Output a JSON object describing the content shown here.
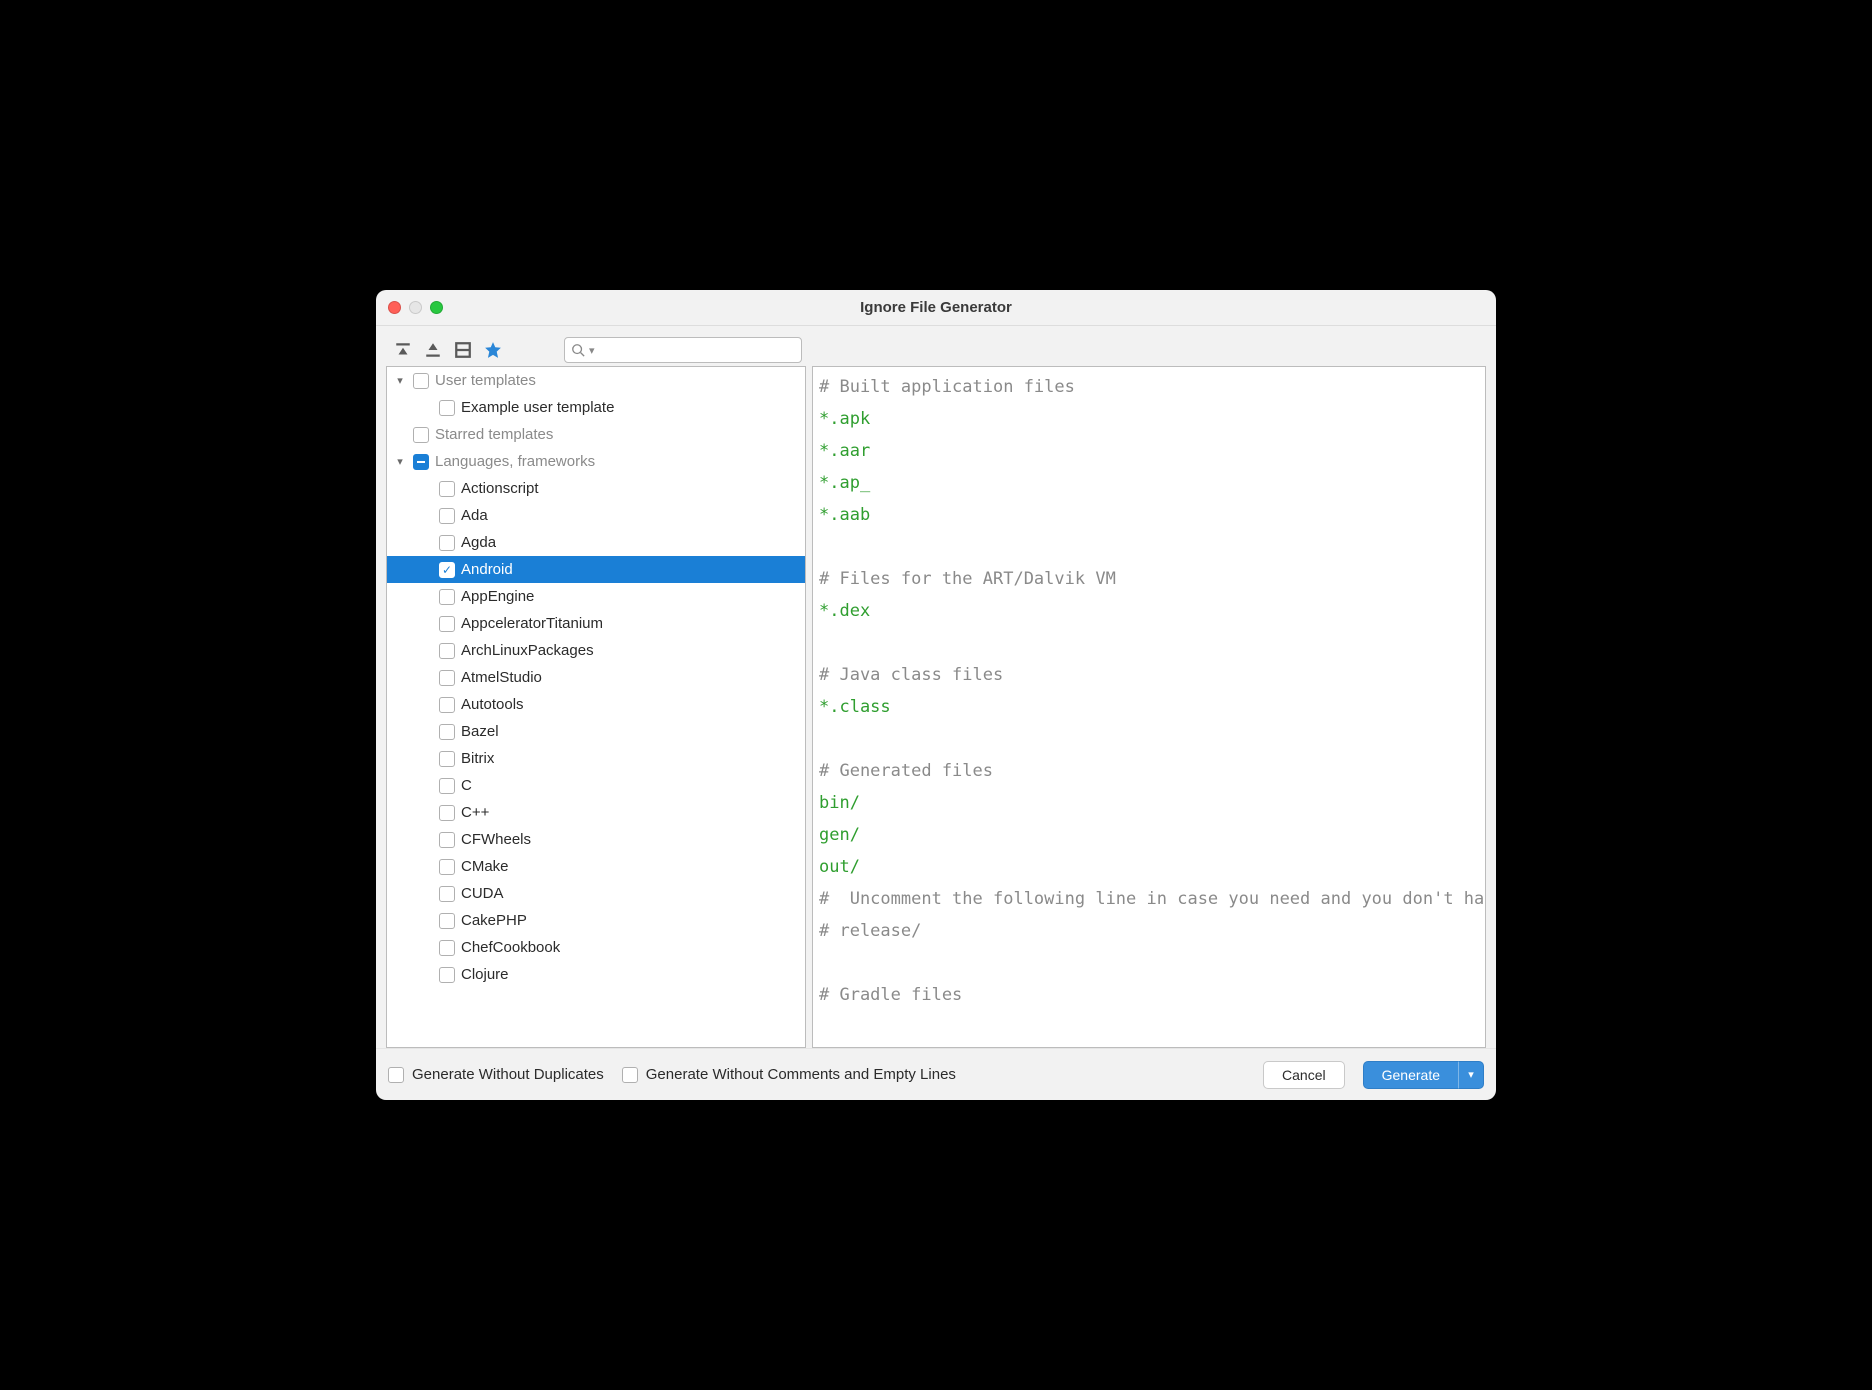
{
  "window": {
    "title": "Ignore File Generator"
  },
  "search": {
    "placeholder": ""
  },
  "tree": {
    "user_templates": {
      "label": "User templates",
      "expanded": true,
      "checked": false,
      "children": [
        {
          "id": "example",
          "label": "Example user template",
          "checked": false
        }
      ]
    },
    "starred_templates": {
      "label": "Starred templates",
      "checked": false
    },
    "languages": {
      "label": "Languages, frameworks",
      "expanded": true,
      "state": "indeterminate",
      "items": [
        {
          "id": "actionscript",
          "label": "Actionscript",
          "checked": false
        },
        {
          "id": "ada",
          "label": "Ada",
          "checked": false
        },
        {
          "id": "agda",
          "label": "Agda",
          "checked": false
        },
        {
          "id": "android",
          "label": "Android",
          "checked": true,
          "selected": true
        },
        {
          "id": "appengine",
          "label": "AppEngine",
          "checked": false
        },
        {
          "id": "appceleratortitanium",
          "label": "AppceleratorTitanium",
          "checked": false
        },
        {
          "id": "archlinuxpackages",
          "label": "ArchLinuxPackages",
          "checked": false
        },
        {
          "id": "atmelstudio",
          "label": "AtmelStudio",
          "checked": false
        },
        {
          "id": "autotools",
          "label": "Autotools",
          "checked": false
        },
        {
          "id": "bazel",
          "label": "Bazel",
          "checked": false
        },
        {
          "id": "bitrix",
          "label": "Bitrix",
          "checked": false
        },
        {
          "id": "c",
          "label": "C",
          "checked": false
        },
        {
          "id": "cpp",
          "label": "C++",
          "checked": false
        },
        {
          "id": "cfwheels",
          "label": "CFWheels",
          "checked": false
        },
        {
          "id": "cmake",
          "label": "CMake",
          "checked": false
        },
        {
          "id": "cuda",
          "label": "CUDA",
          "checked": false
        },
        {
          "id": "cakephp",
          "label": "CakePHP",
          "checked": false
        },
        {
          "id": "chefcookbook",
          "label": "ChefCookbook",
          "checked": false
        },
        {
          "id": "clojure",
          "label": "Clojure",
          "checked": false
        }
      ]
    }
  },
  "preview": {
    "lines": [
      {
        "text": "# Built application files",
        "kind": "comment"
      },
      {
        "text": "*.apk",
        "kind": "pattern"
      },
      {
        "text": "*.aar",
        "kind": "pattern"
      },
      {
        "text": "*.ap_",
        "kind": "pattern"
      },
      {
        "text": "*.aab",
        "kind": "pattern"
      },
      {
        "text": "",
        "kind": "blank"
      },
      {
        "text": "# Files for the ART/Dalvik VM",
        "kind": "comment"
      },
      {
        "text": "*.dex",
        "kind": "pattern"
      },
      {
        "text": "",
        "kind": "blank"
      },
      {
        "text": "# Java class files",
        "kind": "comment"
      },
      {
        "text": "*.class",
        "kind": "pattern"
      },
      {
        "text": "",
        "kind": "blank"
      },
      {
        "text": "# Generated files",
        "kind": "comment"
      },
      {
        "text": "bin/",
        "kind": "pattern"
      },
      {
        "text": "gen/",
        "kind": "pattern"
      },
      {
        "text": "out/",
        "kind": "pattern"
      },
      {
        "text": "#  Uncomment the following line in case you need and you don't have the release build type files in your app",
        "kind": "comment"
      },
      {
        "text": "# release/",
        "kind": "comment"
      },
      {
        "text": "",
        "kind": "blank"
      },
      {
        "text": "# Gradle files",
        "kind": "comment"
      }
    ]
  },
  "footer": {
    "generate_without_duplicates": "Generate Without Duplicates",
    "generate_without_comments": "Generate Without Comments and Empty Lines",
    "cancel": "Cancel",
    "generate": "Generate"
  }
}
